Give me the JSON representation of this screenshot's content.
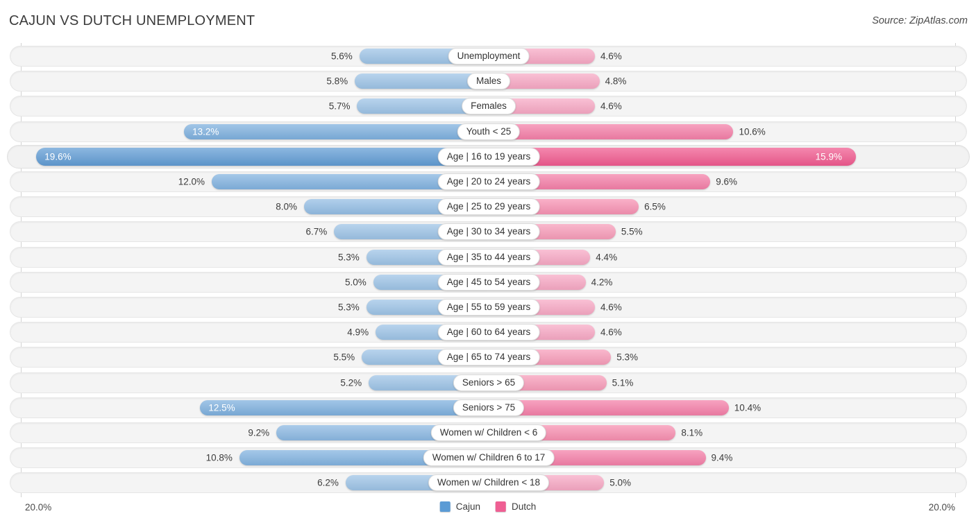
{
  "header": {
    "title": "CAJUN VS DUTCH UNEMPLOYMENT",
    "source": "Source: ZipAtlas.com"
  },
  "axis": {
    "min_label": "20.0%",
    "max_label": "20.0%"
  },
  "legend": [
    {
      "name": "Cajun",
      "color": "#5b9bd5"
    },
    {
      "name": "Dutch",
      "color": "#ef5f93"
    }
  ],
  "chart_data": {
    "type": "bar",
    "title": "CAJUN VS DUTCH UNEMPLOYMENT",
    "subtitle": "Source: ZipAtlas.com",
    "orientation": "horizontal-diverging",
    "xlabel": "",
    "ylabel": "",
    "axis_max_percent": 20.0,
    "axis_left_tick": "20.0%",
    "axis_right_tick": "20.0%",
    "grid": false,
    "legend_position": "bottom-center",
    "categories": [
      "Unemployment",
      "Males",
      "Females",
      "Youth < 25",
      "Age | 16 to 19 years",
      "Age | 20 to 24 years",
      "Age | 25 to 29 years",
      "Age | 30 to 34 years",
      "Age | 35 to 44 years",
      "Age | 45 to 54 years",
      "Age | 55 to 59 years",
      "Age | 60 to 64 years",
      "Age | 65 to 74 years",
      "Seniors > 65",
      "Seniors > 75",
      "Women w/ Children < 6",
      "Women w/ Children 6 to 17",
      "Women w/ Children < 18"
    ],
    "series": [
      {
        "name": "Cajun",
        "color": "#5b9bd5",
        "side": "left",
        "values": [
          5.6,
          5.8,
          5.7,
          13.2,
          19.6,
          12.0,
          8.0,
          6.7,
          5.3,
          5.0,
          5.3,
          4.9,
          5.5,
          5.2,
          12.5,
          9.2,
          10.8,
          6.2
        ]
      },
      {
        "name": "Dutch",
        "color": "#ef5f93",
        "side": "right",
        "values": [
          4.6,
          4.8,
          4.6,
          10.6,
          15.9,
          9.6,
          6.5,
          5.5,
          4.4,
          4.2,
          4.6,
          4.6,
          5.3,
          5.1,
          10.4,
          8.1,
          9.4,
          5.0
        ]
      }
    ]
  },
  "rows": [
    {
      "label": "Unemployment",
      "left": "5.6%",
      "right": "4.6%",
      "leftVal": 5.6,
      "rightVal": 4.6,
      "leftColor": "#9dc3e6",
      "rightColor": "#f7a8c4",
      "leftInside": false,
      "rightInside": false,
      "highlight": false
    },
    {
      "label": "Males",
      "left": "5.8%",
      "right": "4.8%",
      "leftVal": 5.8,
      "rightVal": 4.8,
      "leftColor": "#9dc3e6",
      "rightColor": "#f7a8c4",
      "leftInside": false,
      "rightInside": false,
      "highlight": false
    },
    {
      "label": "Females",
      "left": "5.7%",
      "right": "4.6%",
      "leftVal": 5.7,
      "rightVal": 4.6,
      "leftColor": "#9dc3e6",
      "rightColor": "#f7a8c4",
      "leftInside": false,
      "rightInside": false,
      "highlight": false
    },
    {
      "label": "Youth < 25",
      "left": "13.2%",
      "right": "10.6%",
      "leftVal": 13.2,
      "rightVal": 10.6,
      "leftColor": "#7eb0de",
      "rightColor": "#f47fa8",
      "leftInside": true,
      "rightInside": false,
      "highlight": false
    },
    {
      "label": "Age | 16 to 19 years",
      "left": "19.6%",
      "right": "15.9%",
      "leftVal": 19.6,
      "rightVal": 15.9,
      "leftColor": "#619cd4",
      "rightColor": "#f05a8f",
      "leftInside": true,
      "rightInside": true,
      "highlight": true
    },
    {
      "label": "Age | 20 to 24 years",
      "left": "12.0%",
      "right": "9.6%",
      "leftVal": 12.0,
      "rightVal": 9.6,
      "leftColor": "#82b3e0",
      "rightColor": "#f47fa8",
      "leftInside": false,
      "rightInside": false,
      "highlight": false
    },
    {
      "label": "Age | 25 to 29 years",
      "left": "8.0%",
      "right": "6.5%",
      "leftVal": 8.0,
      "rightVal": 6.5,
      "leftColor": "#93bde4",
      "rightColor": "#f792b3",
      "leftInside": false,
      "rightInside": false,
      "highlight": false
    },
    {
      "label": "Age | 30 to 34 years",
      "left": "6.7%",
      "right": "5.5%",
      "leftVal": 6.7,
      "rightVal": 5.5,
      "leftColor": "#9dc3e6",
      "rightColor": "#f79cb9",
      "leftInside": false,
      "rightInside": false,
      "highlight": false
    },
    {
      "label": "Age | 35 to 44 years",
      "left": "5.3%",
      "right": "4.4%",
      "leftVal": 5.3,
      "rightVal": 4.4,
      "leftColor": "#9dc3e6",
      "rightColor": "#f7a8c4",
      "leftInside": false,
      "rightInside": false,
      "highlight": false
    },
    {
      "label": "Age | 45 to 54 years",
      "left": "5.0%",
      "right": "4.2%",
      "leftVal": 5.0,
      "rightVal": 4.2,
      "leftColor": "#9dc3e6",
      "rightColor": "#f7a8c4",
      "leftInside": false,
      "rightInside": false,
      "highlight": false
    },
    {
      "label": "Age | 55 to 59 years",
      "left": "5.3%",
      "right": "4.6%",
      "leftVal": 5.3,
      "rightVal": 4.6,
      "leftColor": "#9dc3e6",
      "rightColor": "#f7a8c4",
      "leftInside": false,
      "rightInside": false,
      "highlight": false
    },
    {
      "label": "Age | 60 to 64 years",
      "left": "4.9%",
      "right": "4.6%",
      "leftVal": 4.9,
      "rightVal": 4.6,
      "leftColor": "#9dc3e6",
      "rightColor": "#f7a8c4",
      "leftInside": false,
      "rightInside": false,
      "highlight": false
    },
    {
      "label": "Age | 65 to 74 years",
      "left": "5.5%",
      "right": "5.3%",
      "leftVal": 5.5,
      "rightVal": 5.3,
      "leftColor": "#9dc3e6",
      "rightColor": "#f79cb9",
      "leftInside": false,
      "rightInside": false,
      "highlight": false
    },
    {
      "label": "Seniors > 65",
      "left": "5.2%",
      "right": "5.1%",
      "leftVal": 5.2,
      "rightVal": 5.1,
      "leftColor": "#9dc3e6",
      "rightColor": "#f79cb9",
      "leftInside": false,
      "rightInside": false,
      "highlight": false
    },
    {
      "label": "Seniors > 75",
      "left": "12.5%",
      "right": "10.4%",
      "leftVal": 12.5,
      "rightVal": 10.4,
      "leftColor": "#7eb0de",
      "rightColor": "#f47fa8",
      "leftInside": true,
      "rightInside": false,
      "highlight": false
    },
    {
      "label": "Women w/ Children < 6",
      "left": "9.2%",
      "right": "8.1%",
      "leftVal": 9.2,
      "rightVal": 8.1,
      "leftColor": "#8bb8e2",
      "rightColor": "#f78fb0",
      "leftInside": false,
      "rightInside": false,
      "highlight": false
    },
    {
      "label": "Women w/ Children 6 to 17",
      "left": "10.8%",
      "right": "9.4%",
      "leftVal": 10.8,
      "rightVal": 9.4,
      "leftColor": "#82b3e0",
      "rightColor": "#f47fa8",
      "leftInside": false,
      "rightInside": false,
      "highlight": false
    },
    {
      "label": "Women w/ Children < 18",
      "left": "6.2%",
      "right": "5.0%",
      "leftVal": 6.2,
      "rightVal": 5.0,
      "leftColor": "#9dc3e6",
      "rightColor": "#f7a8c4",
      "leftInside": false,
      "rightInside": false,
      "highlight": false
    }
  ]
}
